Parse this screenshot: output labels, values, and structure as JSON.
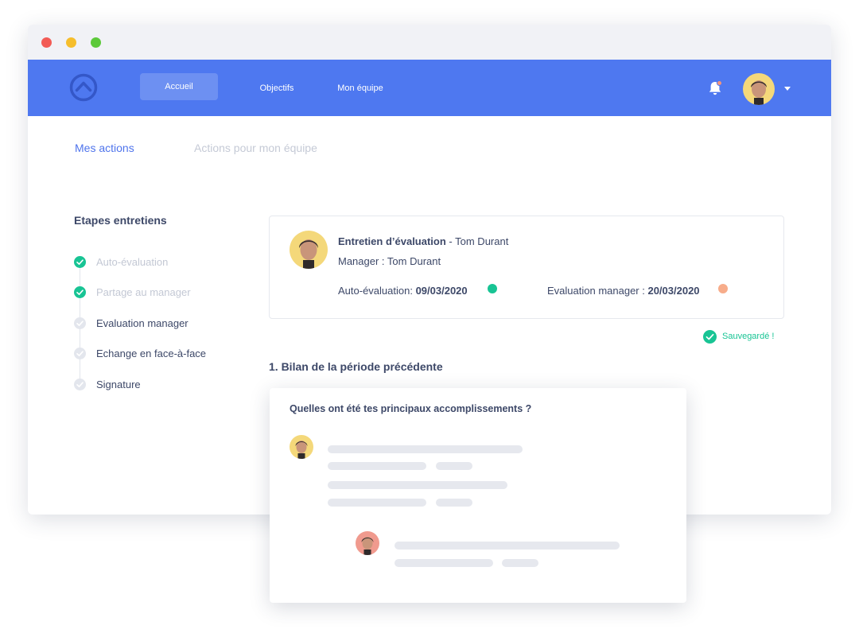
{
  "window": {
    "controls": [
      "close",
      "minimize",
      "maximize"
    ]
  },
  "navbar": {
    "color": "#4e78f0",
    "logo": "chevron-up-circle-icon",
    "items": [
      {
        "label": "Accueil",
        "active": true
      },
      {
        "label": "Objectifs",
        "active": false
      },
      {
        "label": "Mon équipe",
        "active": false
      }
    ],
    "bell_icon": "bell-icon",
    "has_notification": true,
    "caret_icon": "caret-down-icon"
  },
  "tabs": [
    {
      "label": "Mes actions",
      "active": true
    },
    {
      "label": "Actions pour mon équipe",
      "active": false
    }
  ],
  "steps": {
    "title": "Etapes entretiens",
    "items": [
      {
        "label": "Auto-évaluation",
        "status": "done"
      },
      {
        "label": "Partage au manager",
        "status": "done"
      },
      {
        "label": "Evaluation manager",
        "status": "todo"
      },
      {
        "label": "Echange en face-à-face",
        "status": "todo"
      },
      {
        "label": "Signature",
        "status": "todo"
      }
    ]
  },
  "interview": {
    "title": "Entretien d’évaluation",
    "employee": " - Tom Durant",
    "manager_line": "Manager : Tom Durant",
    "self_eval_label": "Auto-évaluation: ",
    "self_eval_date": "09/03/2020",
    "self_eval_status_color": "#18c494",
    "manager_eval_label": "Evaluation manager : ",
    "manager_eval_date": "20/03/2020",
    "manager_eval_status_color": "#f7ac8a"
  },
  "saved": {
    "label": "Sauvegardé !",
    "color": "#18c494"
  },
  "section": {
    "title": "1. Bilan de la période précédente"
  },
  "question": {
    "title": "Quelles ont été tes principaux accomplissements ?"
  }
}
